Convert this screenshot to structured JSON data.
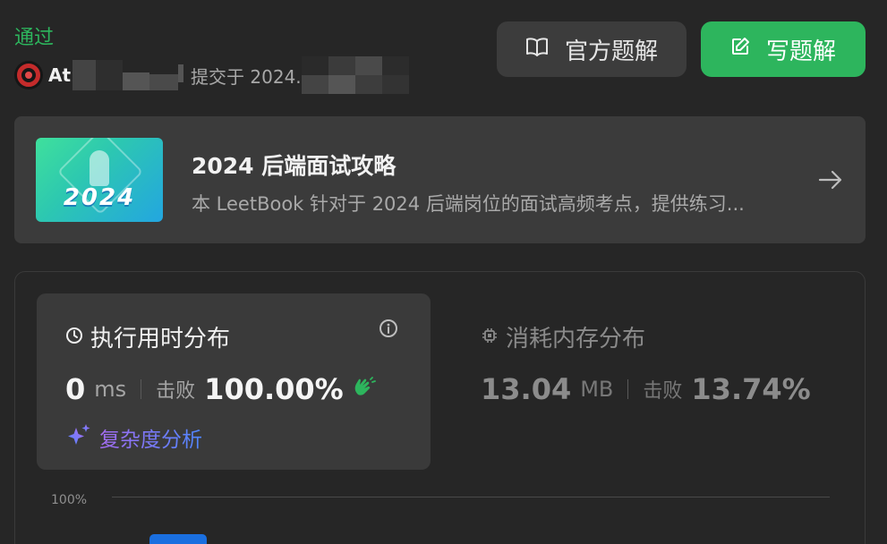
{
  "header": {
    "status": "通过",
    "user_prefix": "At",
    "submitted_label": "提交于 2024."
  },
  "buttons": {
    "official_solution": "官方题解",
    "write_solution": "写题解"
  },
  "leetbook": {
    "cover_text": "2024",
    "title": "2024 后端面试攻略",
    "description": "本 LeetBook 针对于 2024 后端岗位的面试高频考点，提供练习..."
  },
  "runtime": {
    "title": "执行用时分布",
    "value": "0",
    "unit": "ms",
    "beat_label": "击败",
    "percent": "100.00%",
    "analysis_link": "复杂度分析"
  },
  "memory": {
    "title": "消耗内存分布",
    "value": "13.04",
    "unit": "MB",
    "beat_label": "击败",
    "percent": "13.74%"
  },
  "distribution_chart": {
    "y_axis_top_label": "100%"
  },
  "colors": {
    "accent_green": "#2db55d",
    "bar_blue": "#1a6fe0",
    "background": "#262626"
  }
}
